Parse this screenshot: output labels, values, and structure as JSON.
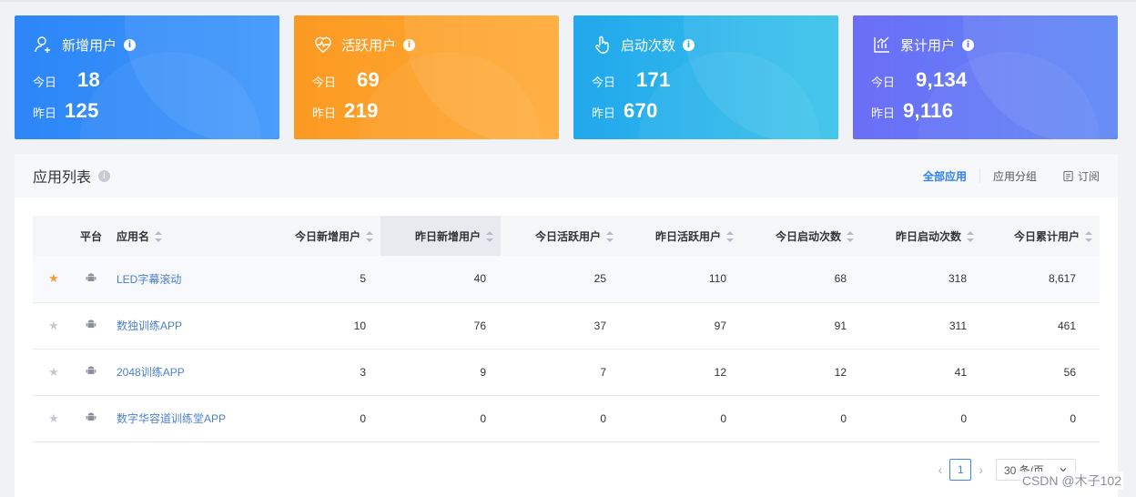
{
  "cards": [
    {
      "title": "新增用户",
      "today_label": "今日",
      "today": "18",
      "yesterday_label": "昨日",
      "yesterday": "125",
      "icon": "user-add-icon"
    },
    {
      "title": "活跃用户",
      "today_label": "今日",
      "today": "69",
      "yesterday_label": "昨日",
      "yesterday": "219",
      "icon": "heartbeat-icon"
    },
    {
      "title": "启动次数",
      "today_label": "今日",
      "today": "171",
      "yesterday_label": "昨日",
      "yesterday": "670",
      "icon": "touch-icon"
    },
    {
      "title": "累计用户",
      "today_label": "今日",
      "today": "9,134",
      "yesterday_label": "昨日",
      "yesterday": "9,116",
      "icon": "chart-icon"
    }
  ],
  "panel": {
    "title": "应用列表",
    "actions": {
      "all": "全部应用",
      "group": "应用分组",
      "subscribe": "订阅"
    }
  },
  "table": {
    "headers": {
      "platform": "平台",
      "app": "应用名",
      "today_new": "今日新增用户",
      "yest_new": "昨日新增用户",
      "today_active": "今日活跃用户",
      "yest_active": "昨日活跃用户",
      "today_launch": "今日启动次数",
      "yest_launch": "昨日启动次数",
      "today_total": "今日累计用户"
    },
    "rows": [
      {
        "starred": true,
        "app": "LED字幕滚动",
        "today_new": "5",
        "yest_new": "40",
        "today_active": "25",
        "yest_active": "110",
        "today_launch": "68",
        "yest_launch": "318",
        "today_total": "8,617"
      },
      {
        "starred": false,
        "app": "数独训练APP",
        "today_new": "10",
        "yest_new": "76",
        "today_active": "37",
        "yest_active": "97",
        "today_launch": "91",
        "yest_launch": "311",
        "today_total": "461"
      },
      {
        "starred": false,
        "app": "2048训练APP",
        "today_new": "3",
        "yest_new": "9",
        "today_active": "7",
        "yest_active": "12",
        "today_launch": "12",
        "yest_launch": "41",
        "today_total": "56"
      },
      {
        "starred": false,
        "app": "数字华容道训练堂APP",
        "today_new": "0",
        "yest_new": "0",
        "today_active": "0",
        "yest_active": "0",
        "today_launch": "0",
        "yest_launch": "0",
        "today_total": "0"
      }
    ]
  },
  "pager": {
    "page": "1",
    "page_size": "30 条/页"
  },
  "watermark": "CSDN @木子102",
  "colors": {
    "blue": "#2d86f7",
    "orange": "#fb9a22",
    "cyan": "#22a8ec",
    "purple": "#6c6ef7",
    "link": "#4a7fd4",
    "star_active": "#f79a3a",
    "star_inactive": "#c4c8d0"
  }
}
